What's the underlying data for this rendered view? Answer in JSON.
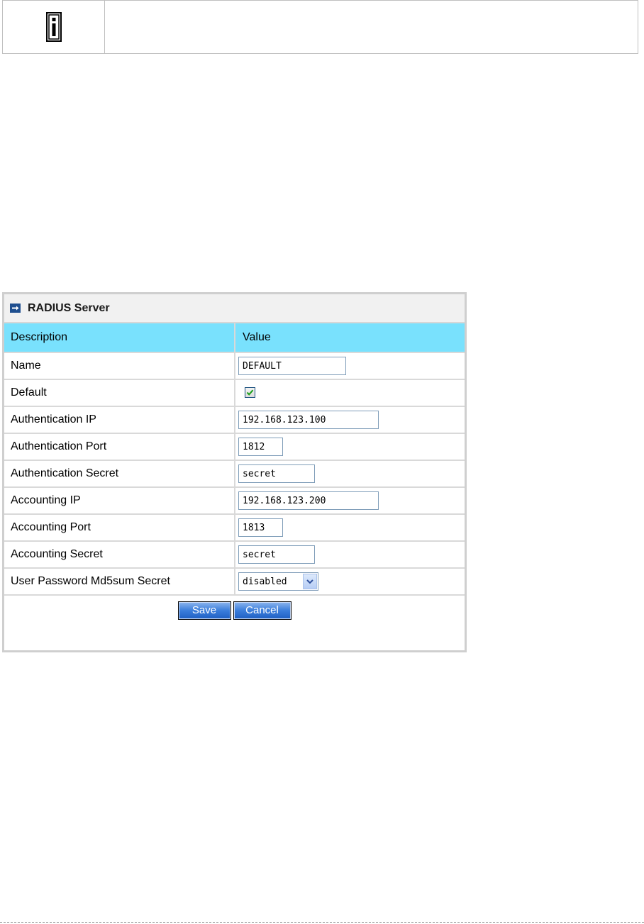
{
  "icons": {
    "note": "info-icon",
    "panel": "arrow-right-icon",
    "dropdown": "chevron-down-icon",
    "check": "checkmark-icon"
  },
  "colors": {
    "header_row": "#79e1fd",
    "button": "#3a7ddb",
    "panel_icon": "#1f4f8f"
  },
  "panel": {
    "title": "RADIUS Server",
    "columns": {
      "description": "Description",
      "value": "Value"
    },
    "rows": {
      "name": {
        "label": "Name",
        "value": "DEFAULT"
      },
      "default": {
        "label": "Default",
        "checked": true
      },
      "auth_ip": {
        "label": "Authentication IP",
        "value": "192.168.123.100"
      },
      "auth_port": {
        "label": "Authentication Port",
        "value": "1812"
      },
      "auth_secret": {
        "label": "Authentication Secret",
        "value": "secret"
      },
      "acct_ip": {
        "label": "Accounting IP",
        "value": "192.168.123.200"
      },
      "acct_port": {
        "label": "Accounting Port",
        "value": "1813"
      },
      "acct_secret": {
        "label": "Accounting Secret",
        "value": "secret"
      },
      "md5": {
        "label": "User Password Md5sum Secret",
        "value": "disabled"
      }
    },
    "buttons": {
      "save": "Save",
      "cancel": "Cancel"
    }
  }
}
